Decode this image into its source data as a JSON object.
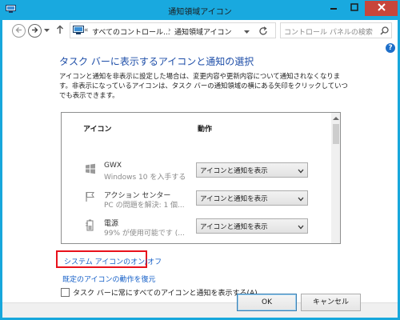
{
  "window": {
    "title": "通知領域アイコン",
    "title_icon": "control-panel-icon",
    "controls": {
      "minimize": "minimize-icon",
      "maximize": "maximize-icon",
      "close": "close-icon"
    }
  },
  "nav": {
    "breadcrumb_prefix": "«",
    "breadcrumb_parent": "すべてのコントロール...",
    "breadcrumb_separator": "›",
    "breadcrumb_current": "通知領域アイコン",
    "search_placeholder": "コントロール パネルの検索"
  },
  "help": {
    "label": "?"
  },
  "main": {
    "heading": "タスク バーに表示するアイコンと通知の選択",
    "description": "アイコンと通知を非表示に設定した場合は、変更内容や更新内容について通知されなくなります。非表示になっているアイコンは、タスク バーの通知領域の横にある矢印をクリックしていつでも表示できます。"
  },
  "icon_list": {
    "columns": {
      "icon": "アイコン",
      "behavior": "動作"
    },
    "rows": [
      {
        "name": "GWX",
        "subtitle": "Windows 10 を入手する",
        "behavior": "アイコンと通知を表示",
        "icon": "windows-logo-icon"
      },
      {
        "name": "アクション センター",
        "subtitle": "PC の問題を解決: 1 個...",
        "behavior": "アイコンと通知を表示",
        "icon": "flag-icon"
      },
      {
        "name": "電源",
        "subtitle": "99% が使用可能です (...",
        "behavior": "アイコンと通知を表示",
        "icon": "battery-plug-icon"
      }
    ]
  },
  "links": {
    "system_icons": "システム アイコンのオン/オフ",
    "restore_defaults": "既定のアイコンの動作を復元"
  },
  "always_show": {
    "label": "タスク バーに常にすべてのアイコンと通知を表示する(A)",
    "checked": false
  },
  "buttons": {
    "ok": "OK",
    "cancel": "キャンセル"
  },
  "colors": {
    "titlebar": "#19a9df",
    "close_button": "#c7463b",
    "heading": "#1e4ea8",
    "link": "#1660c8",
    "highlight_box": "#e8111b"
  }
}
